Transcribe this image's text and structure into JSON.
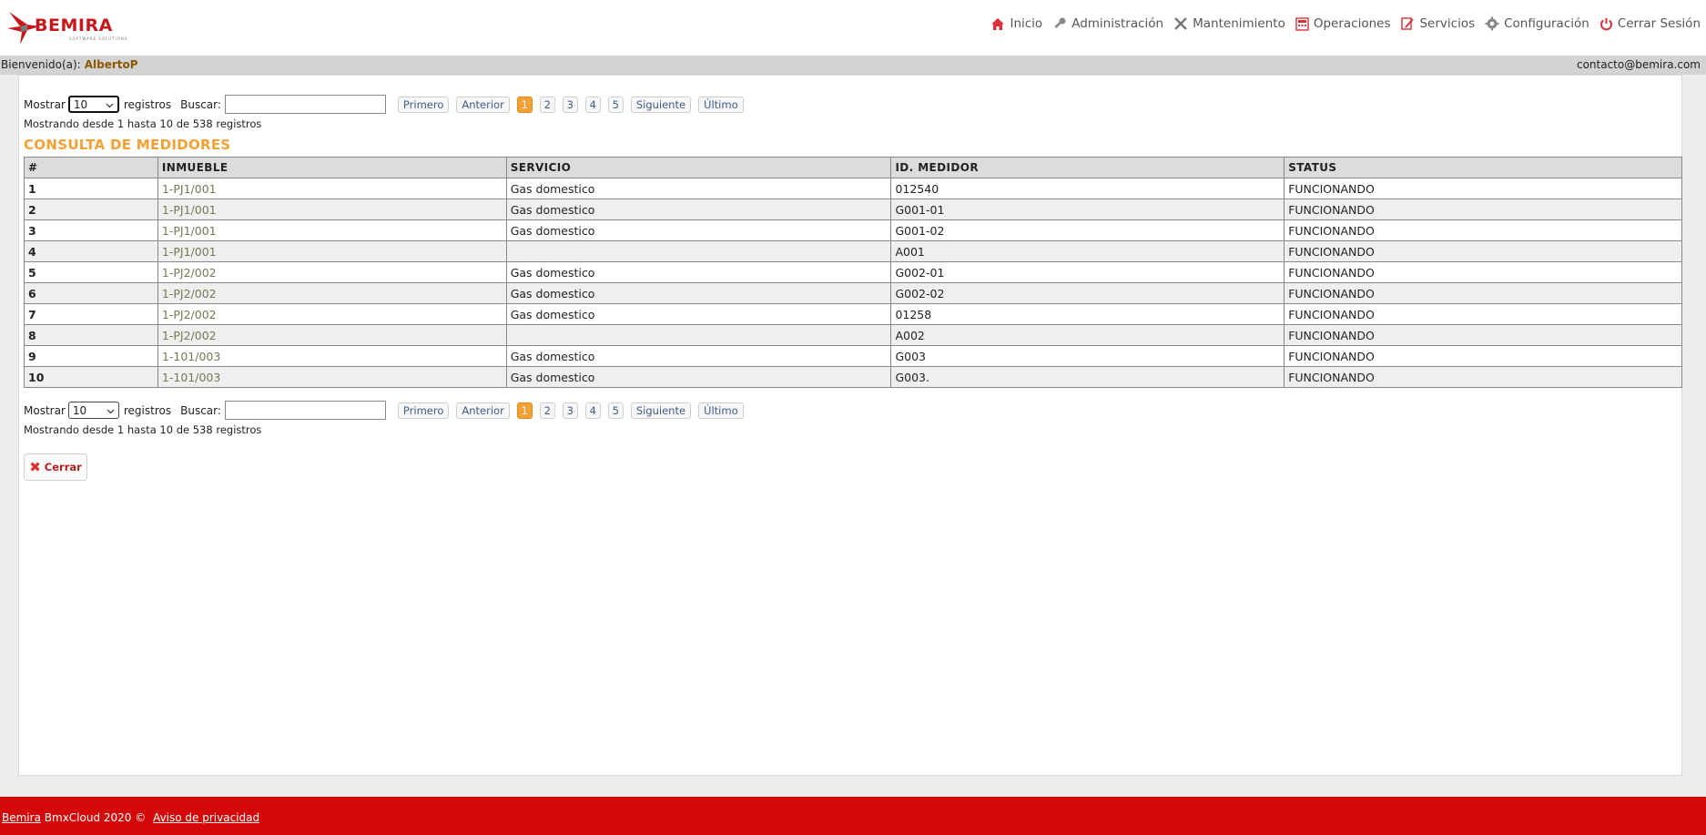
{
  "header": {
    "logo_text": "BEMIRA",
    "logo_tagline": "SOFTWARE SOLUTIONS",
    "nav": [
      {
        "label": "Inicio",
        "icon": "home-icon"
      },
      {
        "label": "Administración",
        "icon": "key-icon"
      },
      {
        "label": "Mantenimiento",
        "icon": "tools-icon"
      },
      {
        "label": "Operaciones",
        "icon": "calculator-icon"
      },
      {
        "label": "Servicios",
        "icon": "edit-icon"
      },
      {
        "label": "Configuración",
        "icon": "gear-icon"
      },
      {
        "label": "Cerrar Sesión",
        "icon": "power-icon"
      }
    ]
  },
  "welcome": {
    "label": "Bienvenido(a):",
    "user": "AlbertoP",
    "email": "contacto@bemira.com"
  },
  "controls": {
    "show_label": "Mostrar",
    "page_size": "10",
    "records_label": "registros",
    "search_label": "Buscar:",
    "search_value": "",
    "pager": {
      "first": "Primero",
      "prev": "Anterior",
      "pages": [
        "1",
        "2",
        "3",
        "4",
        "5"
      ],
      "active_page": "1",
      "next": "Siguiente",
      "last": "Último"
    },
    "info": "Mostrando desde 1 hasta 10 de 538 registros"
  },
  "title": "CONSULTA DE MEDIDORES",
  "table": {
    "headers": [
      "#",
      "INMUEBLE",
      "SERVICIO",
      "ID. MEDIDOR",
      "STATUS"
    ],
    "rows": [
      [
        "1",
        "1-PJ1/001",
        "Gas domestico",
        "012540",
        "FUNCIONANDO"
      ],
      [
        "2",
        "1-PJ1/001",
        "Gas domestico",
        "G001-01",
        "FUNCIONANDO"
      ],
      [
        "3",
        "1-PJ1/001",
        "Gas domestico",
        "G001-02",
        "FUNCIONANDO"
      ],
      [
        "4",
        "1-PJ1/001",
        "",
        "A001",
        "FUNCIONANDO"
      ],
      [
        "5",
        "1-PJ2/002",
        "Gas domestico",
        "G002-01",
        "FUNCIONANDO"
      ],
      [
        "6",
        "1-PJ2/002",
        "Gas domestico",
        "G002-02",
        "FUNCIONANDO"
      ],
      [
        "7",
        "1-PJ2/002",
        "Gas domestico",
        "01258",
        "FUNCIONANDO"
      ],
      [
        "8",
        "1-PJ2/002",
        "",
        "A002",
        "FUNCIONANDO"
      ],
      [
        "9",
        "1-101/003",
        "Gas domestico",
        "G003",
        "FUNCIONANDO"
      ],
      [
        "10",
        "1-101/003",
        "Gas domestico",
        "G003.",
        "FUNCIONANDO"
      ]
    ]
  },
  "close_button": "Cerrar",
  "footer": {
    "brand_link": "Bemira",
    "text": "BmxCloud 2020 ©",
    "privacy_link": "Aviso de privacidad"
  },
  "colors": {
    "accent": "#f5a033",
    "brand_red": "#d40808",
    "user_color": "#8a5a00"
  }
}
